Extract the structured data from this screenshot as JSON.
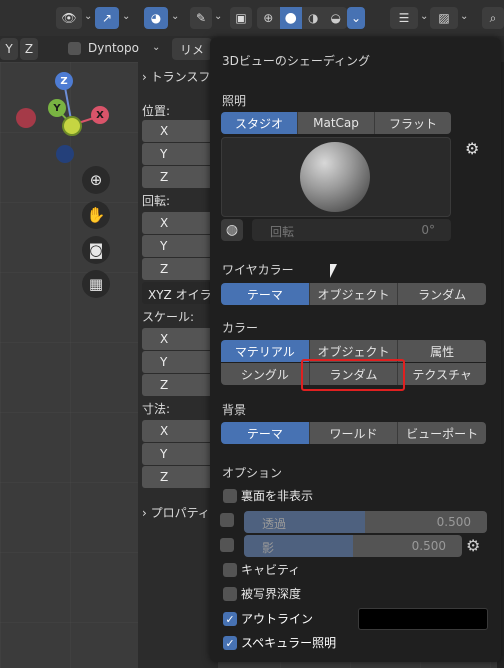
{
  "header": {
    "mode_items": [
      "Y",
      "Z"
    ],
    "dyntopo_label": "Dyntopo",
    "remesh_label": "リメ"
  },
  "npanel": {
    "transform_title": "トランスフ",
    "location_label": "位置:",
    "rotation_label": "回転:",
    "rotation_mode": "XYZ オイラ",
    "scale_label": "スケール:",
    "dimensions_label": "寸法:",
    "axes": [
      "X",
      "Y",
      "Z"
    ],
    "properties_label": "プロパティ"
  },
  "gizmo": {
    "x": "X",
    "y": "Y",
    "z": "Z"
  },
  "popover": {
    "title": "3Dビューのシェーディング",
    "lighting": {
      "label": "照明",
      "options": [
        "スタジオ",
        "MatCap",
        "フラット"
      ],
      "selected": 0,
      "rotation_label": "回転",
      "rotation_value": "0°"
    },
    "wire_color": {
      "label": "ワイヤカラー",
      "options": [
        "テーマ",
        "オブジェクト",
        "ランダム"
      ],
      "selected": 0
    },
    "color": {
      "label": "カラー",
      "row1": [
        "マテリアル",
        "オブジェクト",
        "属性"
      ],
      "row2": [
        "シングル",
        "ランダム",
        "テクスチャ"
      ],
      "selected": "マテリアル",
      "highlight_color": "#e02020"
    },
    "background": {
      "label": "背景",
      "options": [
        "テーマ",
        "ワールド",
        "ビューポート"
      ],
      "selected": 0
    },
    "options": {
      "label": "オプション",
      "backface_culling": {
        "label": "裏面を非表示",
        "checked": false
      },
      "xray": {
        "label": "透過",
        "value": "0.500",
        "fraction": 0.5,
        "checked": false
      },
      "shadow": {
        "label": "影",
        "value": "0.500",
        "fraction": 0.5,
        "checked": false
      },
      "cavity": {
        "label": "キャビティ",
        "checked": false
      },
      "dof": {
        "label": "被写界深度",
        "checked": false
      },
      "outline": {
        "label": "アウトライン",
        "checked": true
      },
      "specular": {
        "label": "スペキュラー照明",
        "checked": true
      }
    },
    "accent_color": "#4772b3"
  }
}
